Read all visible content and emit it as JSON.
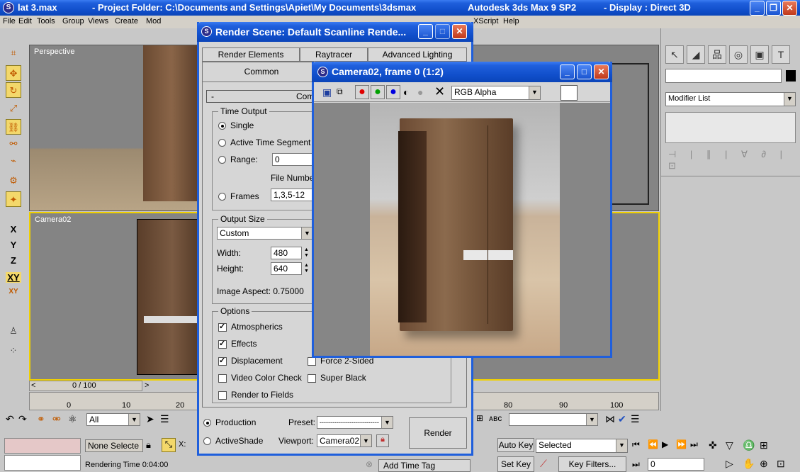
{
  "app": {
    "title": "lat 3.max",
    "project": "- Project Folder: C:\\Documents and Settings\\Apiet\\My Documents\\3dsmax",
    "product": "Autodesk 3ds Max 9 SP2",
    "display": "- Display : Direct 3D"
  },
  "menu": {
    "items": [
      "File",
      "Edit",
      "Tools",
      "Group",
      "Views",
      "Create",
      "Mod"
    ],
    "right_items": [
      "XScript",
      "Help"
    ]
  },
  "viewports": {
    "top_left": "Perspective",
    "bottom_left": "Camera02"
  },
  "axes": [
    "X",
    "Y",
    "Z",
    "XY",
    "XY"
  ],
  "timeline": {
    "frame": "0 / 100",
    "ticks": [
      "0",
      "10",
      "20"
    ],
    "ticks_right": [
      "80",
      "90",
      "100"
    ]
  },
  "status": {
    "selection": "None Selecte",
    "render_time": "Rendering Time 0:04:00",
    "x_label": "X:",
    "add_time_tag": "Add Time Tag",
    "filter_all": "All"
  },
  "anim": {
    "auto_key": "Auto Key",
    "set_key": "Set Key",
    "selected": "Selected",
    "key_filters": "Key Filters...",
    "frame_field": "0"
  },
  "command_panel": {
    "modifier_list": "Modifier List"
  },
  "render_scene": {
    "title": "Render Scene: Default Scanline Rende...",
    "tabs_row1": [
      "Render Elements",
      "Raytracer",
      "Advanced Lighting"
    ],
    "tab_active": "Common",
    "rollout": "Com",
    "rollout_minus": "-",
    "time_output": {
      "label": "Time Output",
      "single": "Single",
      "active_segment": "Active Time Segment",
      "range": "Range:",
      "range_value": "0",
      "file_number": "File Numbe",
      "frames": "Frames",
      "frames_value": "1,3,5-12"
    },
    "output_size": {
      "label": "Output Size",
      "preset": "Custom",
      "width_label": "Width:",
      "width": "480",
      "height_label": "Height:",
      "height": "640",
      "aspect": "Image Aspect: 0.75000"
    },
    "options": {
      "label": "Options",
      "atmospherics": "Atmospherics",
      "effects": "Effects",
      "displacement": "Displacement",
      "force2": "Force 2-Sided",
      "video_color": "Video Color Check",
      "super_black": "Super Black",
      "render_fields": "Render to Fields"
    },
    "production": "Production",
    "activeshade": "ActiveShade",
    "preset_label": "Preset:",
    "preset_value": "----------------------------",
    "viewport_label": "Viewport:",
    "viewport_value": "Camera02",
    "render_button": "Render"
  },
  "frame_window": {
    "title": "Camera02, frame 0 (1:2)",
    "channel": "RGB Alpha",
    "colors": {
      "red": "#e00000",
      "green": "#00a000",
      "blue": "#0000e0"
    }
  }
}
